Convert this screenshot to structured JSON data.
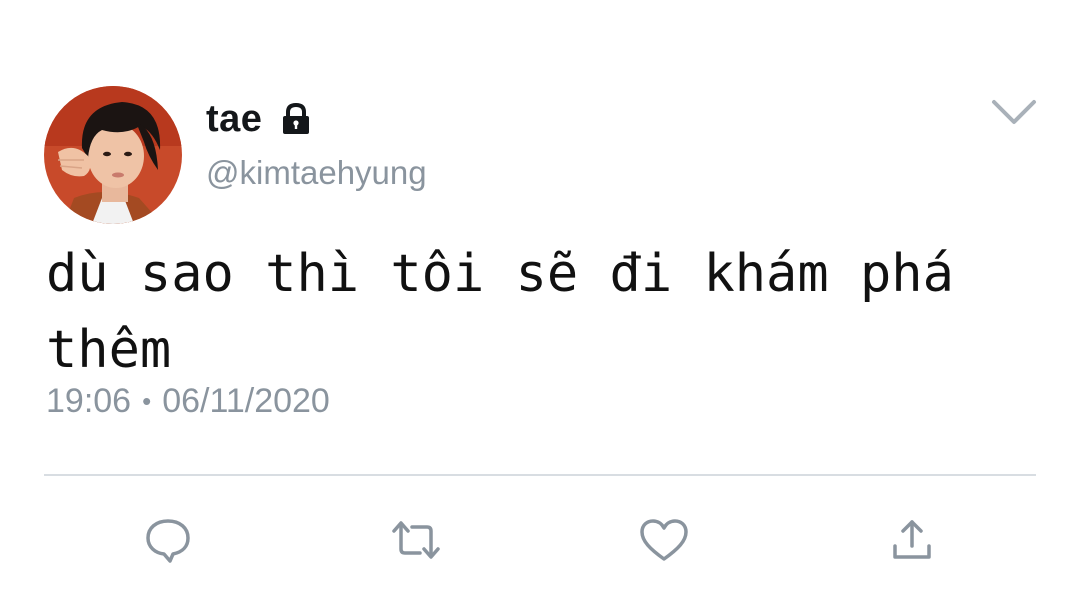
{
  "user": {
    "display_name": "tae",
    "handle": "@kimtaehyung",
    "protected_icon": "lock-icon",
    "avatar_icon": "profile-photo"
  },
  "tweet": {
    "text_line1": "dù sao thì tôi sẽ đi khám phá",
    "text_line2": "thêm",
    "time": "19:06",
    "separator": "•",
    "date": "06/11/2020"
  },
  "menu": {
    "icon": "chevron-down-icon"
  },
  "actions": [
    {
      "name": "reply",
      "icon": "reply-icon"
    },
    {
      "name": "retweet",
      "icon": "retweet-icon"
    },
    {
      "name": "like",
      "icon": "heart-icon"
    },
    {
      "name": "share",
      "icon": "share-icon"
    }
  ],
  "colors": {
    "text_primary": "#14171a",
    "text_secondary": "#8a949e",
    "divider": "#d8dde2",
    "icon": "#8a949e"
  }
}
